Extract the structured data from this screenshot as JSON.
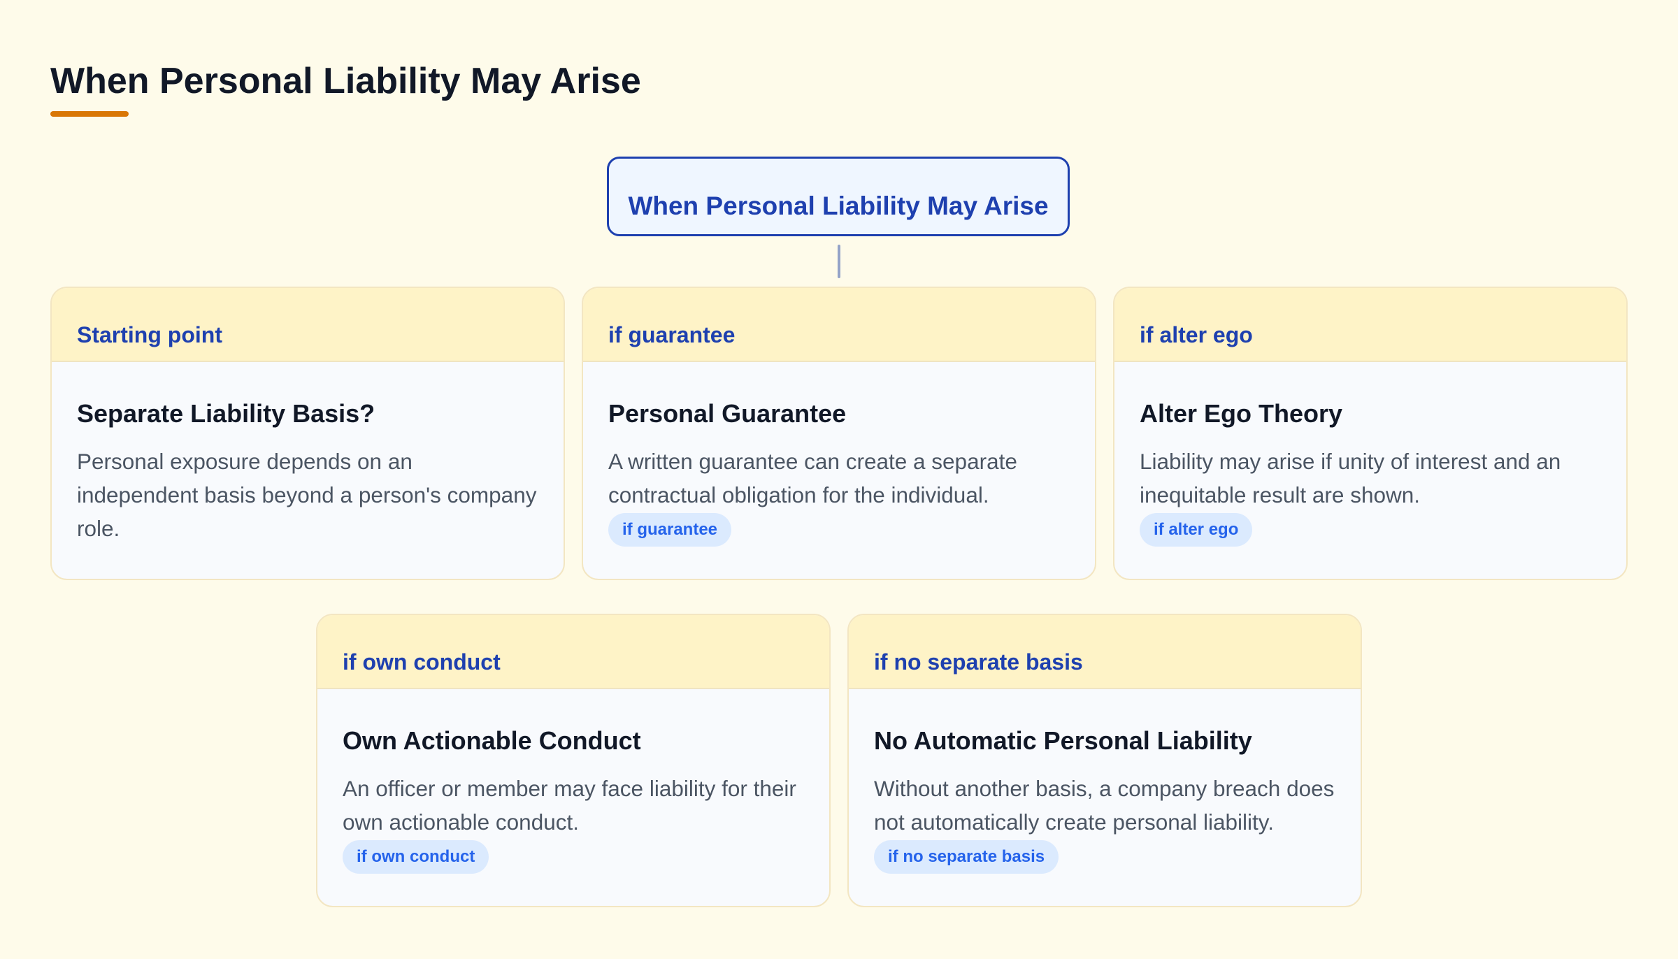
{
  "title": "When Personal Liability May Arise",
  "root_node": {
    "label": "When Personal Liability May Arise"
  },
  "cards": [
    {
      "tag": "Starting point",
      "title": "Separate Liability Basis?",
      "description": "Personal exposure depends on an independent basis beyond a person's company role.",
      "badge": ""
    },
    {
      "tag": "if guarantee",
      "title": "Personal Guarantee",
      "description": "A written guarantee can create a separate contractual obligation for the individual.",
      "badge": "if guarantee"
    },
    {
      "tag": "if alter ego",
      "title": "Alter Ego Theory",
      "description": "Liability may arise if unity of interest and an inequitable result are shown.",
      "badge": "if alter ego"
    },
    {
      "tag": "if own conduct",
      "title": "Own Actionable Conduct",
      "description": "An officer or member may face liability for their own actionable conduct.",
      "badge": "if own conduct"
    },
    {
      "tag": "if no separate basis",
      "title": "No Automatic Personal Liability",
      "description": "Without another basis, a company breach does not automatically create personal liability.",
      "badge": "if no separate basis"
    }
  ],
  "colors": {
    "background": "#fefbea",
    "accent": "#d97706",
    "primary": "#1e40af",
    "card_header": "#fef3c7",
    "badge_bg": "#dbeafe",
    "badge_text": "#2563eb"
  }
}
